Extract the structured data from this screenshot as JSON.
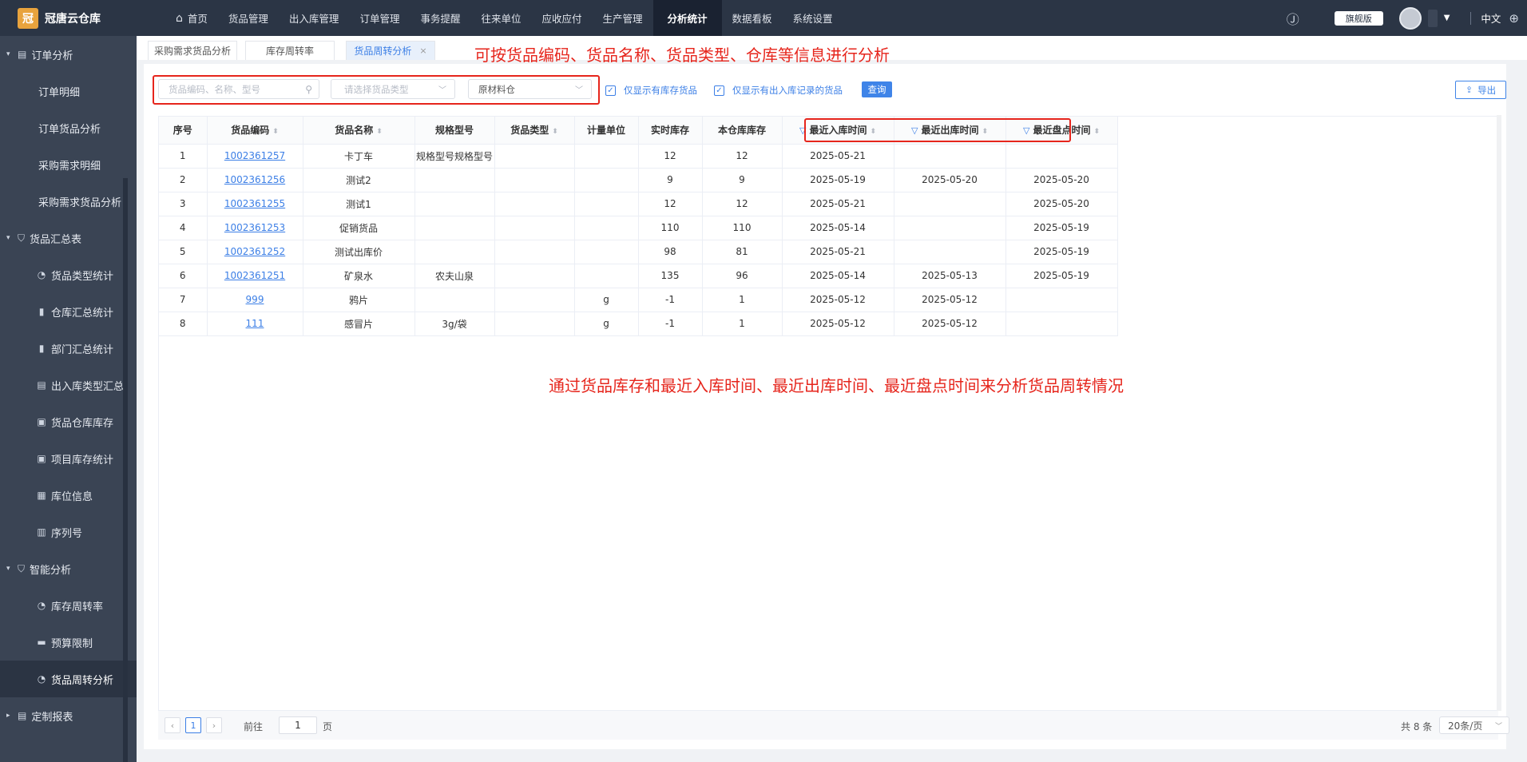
{
  "app": {
    "name": "冠唐云仓库",
    "logo_glyph": "冠"
  },
  "nav": {
    "items": [
      "首页",
      "货品管理",
      "出入库管理",
      "订单管理",
      "事务提醒",
      "往来单位",
      "应收应付",
      "生产管理",
      "分析统计",
      "数据看板",
      "系统设置"
    ],
    "active_index": 8
  },
  "topright": {
    "edition": "旗舰版",
    "language": "中文"
  },
  "sidebar": {
    "groups": [
      {
        "label": "订单分析",
        "items": [
          {
            "label": "订单明细",
            "icon": ""
          },
          {
            "label": "订单货品分析",
            "icon": ""
          },
          {
            "label": "采购需求明细",
            "icon": ""
          },
          {
            "label": "采购需求货品分析",
            "icon": ""
          }
        ]
      },
      {
        "label": "货品汇总表",
        "items": [
          {
            "label": "货品类型统计",
            "icon": "pie-icon"
          },
          {
            "label": "仓库汇总统计",
            "icon": "bar-chart-icon"
          },
          {
            "label": "部门汇总统计",
            "icon": "bar-chart-icon"
          },
          {
            "label": "出入库类型汇总",
            "icon": "trend-icon"
          },
          {
            "label": "货品仓库库存",
            "icon": "box-icon"
          },
          {
            "label": "项目库存统计",
            "icon": "box-icon"
          },
          {
            "label": "库位信息",
            "icon": "grid-icon"
          },
          {
            "label": "序列号",
            "icon": "doc-icon"
          }
        ]
      },
      {
        "label": "智能分析",
        "items": [
          {
            "label": "库存周转率",
            "icon": "pie-icon"
          },
          {
            "label": "预算限制",
            "icon": "monitor-icon"
          },
          {
            "label": "货品周转分析",
            "icon": "pie-icon"
          }
        ]
      },
      {
        "label": "定制报表",
        "items": []
      }
    ],
    "active_item": "货品周转分析"
  },
  "tabs": [
    {
      "label": "采购需求货品分析",
      "active": false
    },
    {
      "label": "库存周转率",
      "active": false
    },
    {
      "label": "货品周转分析",
      "active": true,
      "close": "×"
    }
  ],
  "annotations": {
    "top": "可按货品编码、货品名称、货品类型、仓库等信息进行分析",
    "middle": "通过货品库存和最近入库时间、最近出库时间、最近盘点时间来分析货品周转情况"
  },
  "filters": {
    "search_placeholder": "货品编码、名称、型号",
    "type_placeholder": "请选择货品类型",
    "warehouse_value": "原材料仓",
    "check_stock_label": "仅显示有库存货品",
    "check_records_label": "仅显示有出入库记录的货品",
    "query_label": "查询",
    "export_label": "导出"
  },
  "table": {
    "columns": [
      "序号",
      "货品编码",
      "货品名称",
      "规格型号",
      "货品类型",
      "计量单位",
      "实时库存",
      "本仓库库存",
      "最近入库时间",
      "最近出库时间",
      "最近盘点时间"
    ],
    "rows": [
      [
        "1",
        "1002361257",
        "卡丁车",
        "规格型号规格型号",
        "",
        "",
        "12",
        "12",
        "2025-05-21",
        "",
        ""
      ],
      [
        "2",
        "1002361256",
        "测试2",
        "",
        "",
        "",
        "9",
        "9",
        "2025-05-19",
        "2025-05-20",
        "2025-05-20"
      ],
      [
        "3",
        "1002361255",
        "测试1",
        "",
        "",
        "",
        "12",
        "12",
        "2025-05-21",
        "",
        "2025-05-20"
      ],
      [
        "4",
        "1002361253",
        "促销货品",
        "",
        "",
        "",
        "110",
        "110",
        "2025-05-14",
        "",
        "2025-05-19"
      ],
      [
        "5",
        "1002361252",
        "测试出库价",
        "",
        "",
        "",
        "98",
        "81",
        "2025-05-21",
        "",
        "2025-05-19"
      ],
      [
        "6",
        "1002361251",
        "矿泉水",
        "农夫山泉",
        "",
        "",
        "135",
        "96",
        "2025-05-14",
        "2025-05-13",
        "2025-05-19"
      ],
      [
        "7",
        "999",
        "鸦片",
        "",
        "",
        "g",
        "-1",
        "1",
        "2025-05-12",
        "2025-05-12",
        ""
      ],
      [
        "8",
        "111",
        "感冒片",
        "3g/袋",
        "",
        "g",
        "-1",
        "1",
        "2025-05-12",
        "2025-05-12",
        ""
      ]
    ]
  },
  "pagination": {
    "current_page": "1",
    "goto_prefix": "前往",
    "goto_value": "1",
    "goto_suffix": "页",
    "total": "共 8 条",
    "page_size": "20条/页"
  }
}
